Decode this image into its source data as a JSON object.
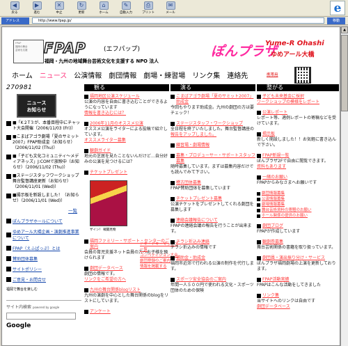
{
  "toolbar": {
    "back": "戻る",
    "forward": "進む",
    "stop": "中止",
    "refresh": "更新",
    "home": "ホーム",
    "autofill": "自動入力",
    "print": "プリント",
    "mail": "メール"
  },
  "address": {
    "label": "アドレス",
    "url": "http://www.fpap.jp/",
    "go": "移動"
  },
  "banner": {
    "logo": "FPAP",
    "kana": "(エフパップ)",
    "org": "福岡・九州の地域舞台芸術文化を支援する NPO 法人",
    "plaza": "ぽんプラザ",
    "yumer": "Yume-R Ohashi",
    "yumer_jp": "ゆめアール大橋"
  },
  "nav": [
    "ホーム",
    "ニュース",
    "公演情報",
    "劇団情報",
    "劇場・練習場",
    "リンク集",
    "連絡先"
  ],
  "mobile_link": "携帯用",
  "counter": "270981",
  "columns": [
    "観る",
    "演る",
    "整がる"
  ],
  "left": {
    "news_head_1": "ニュース",
    "news_head_2": "お知らせ",
    "items": [
      "■「K２T３が、本番目程中にチャット大会開催（2006/11/03 (Fri)）",
      "■こまばアゴラ劇場「夏のサミット2007」FPAP助成金（お知らせ）（2006/11/02 (Thu)）",
      "■「子ども文化コミュニティ〜メディアネッズ」J:COMで放映中（お知らせ）（2006/11/02 (Thu)）",
      "■ステージスタッフワークショップ舞台監督講座更新（お知らせ）（2006/11/01 (Wed)）",
      "■揚示板を新設しました！（お知らせ）（2006/11/01 (Wed)）"
    ],
    "more": "一覧",
    "links": [
      "ぽんプラザホールについて",
      "ゆめアール大橋企画・演劇推進事業について",
      "FPAP（えふぱっぷ）とは",
      "賛助団体募集",
      "サイトポリシー",
      "ご意見・お問合せ"
    ],
    "footer": "福岡で舞台を楽しむ",
    "search_label": "サイト内検索",
    "powered": "powered by google",
    "google": "Google"
  },
  "col1": {
    "items": [
      {
        "t": "福岡地区公演スケジュール",
        "d": "公演の内容を自由に書き込むことができるようになっています",
        "link": "情報を書き込むには？"
      },
      {
        "t": "2006年11月のオススメ公演",
        "d": "オススメ公演をライターによる投稿で紹介しています。",
        "link": "オススメライター募集"
      },
      {
        "t": "観劇ガイド",
        "d": "地元の芝居を見たことないんだけど…自分好みの公演を見つけるには？"
      },
      {
        "t": "チケットプレゼント",
        "d": ""
      }
    ],
    "poster_caption": "ザイン！ 戦闘見物",
    "after": [
      {
        "t": "福岡ファミリー・サポート・センターのご案内",
        "d": "会員の育児支援ネット会員の方へお子様を預けられます"
      },
      {
        "t": "劇団データベース",
        "d": "劇団の情報です。",
        "link": "リンクをご希望の方へ"
      },
      {
        "t": "九州の舞台関係blogリスト",
        "d": "九州の演劇を中心とした舞台関係のblogをリストにしています。"
      },
      {
        "t": "アンケート",
        "d": ""
      }
    ],
    "side": [
      "ドキ・ドキ・マップス一覧",
      "コンペティション大会",
      "劇団登録のご案内",
      "情報を掲載する"
    ]
  },
  "col2": {
    "items": [
      {
        "t": "こまばアゴラ劇場「夏のサミット2007」助成金",
        "d": "今回もやります助成金。九州の劇団の方は要チェック！"
      },
      {
        "t": "ステージスタッフ・ワークショップ",
        "d": "全日程を終了いたしました。舞台監督講座の",
        "link": "報告をアップしました。"
      },
      {
        "t": "練習場・劇場情報",
        "d": ""
      },
      {
        "t": "募集・プロデューサー・サポートスタッフ募集",
        "d": "随時募集しています。まずは募集内容だけでも読んでみて下さい。"
      },
      {
        "t": "稽古団体募集",
        "d": "FPAP賛助団体を募集しています"
      },
      {
        "t": "チケットプレゼント募集",
        "d": "公演チケットをプレゼントしてくれる劇団を募集します"
      },
      {
        "t": "連絡会議報告について",
        "d": "FPAPの連絡会議の報告を行うことが出来ます。"
      },
      {
        "t": "チラシ折込み連絡",
        "d": "チラシ折込みの情報です"
      },
      {
        "t": "補助金・助成金",
        "d": "福岡市近郊で行われる公演の制作を代行します。"
      },
      {
        "t": "スポーツ安全協会のご案内",
        "d": "年間一人５００円で使われる文化・スポーツ団体のための保険"
      }
    ]
  },
  "col3": {
    "items": [
      {
        "t": "子ども未来基金に採択",
        "d": "",
        "link": "ワークショップの模様をレポート"
      },
      {
        "t": "公演レポート",
        "d": "レポート等、適例レポートの寄稿などを受けています。"
      },
      {
        "t": "揭示板",
        "d": "新しく開設しました！！お気軽に書き込んで下さい。"
      },
      {
        "t": "FPAP新規一覧",
        "d": "ぽんプラザ2Fで自由に閲覧できます。",
        "link": "資料もあります"
      },
      {
        "t": "一緒のお願い",
        "d": "FPAPからみなさまへお願いです"
      }
    ],
    "links": [
      "劇団情報募集",
      "公演情報募集",
      "劇場情報募集",
      "舞台芸術資料の寄贈のお願い",
      "ホール関係の提供のお願い"
    ],
    "after": [
      {
        "t": "劇団ブログ",
        "d": "FPAPが作成しています"
      },
      {
        "t": "観劇券募集",
        "d": "舞台芸術関係の書籍を取り扱っています。"
      },
      {
        "t": "劇団員・演出振り分け・サービス",
        "d": "ぽんプラザ福岡劇場の上演を更新しております。"
      },
      {
        "t": "FPAP活動実績",
        "d": "FPAPはこんな活動をしてきました"
      },
      {
        "t": "リンク集",
        "d": "当サイトへのリンクは自由です",
        "link": "劇団データベース"
      }
    ]
  }
}
